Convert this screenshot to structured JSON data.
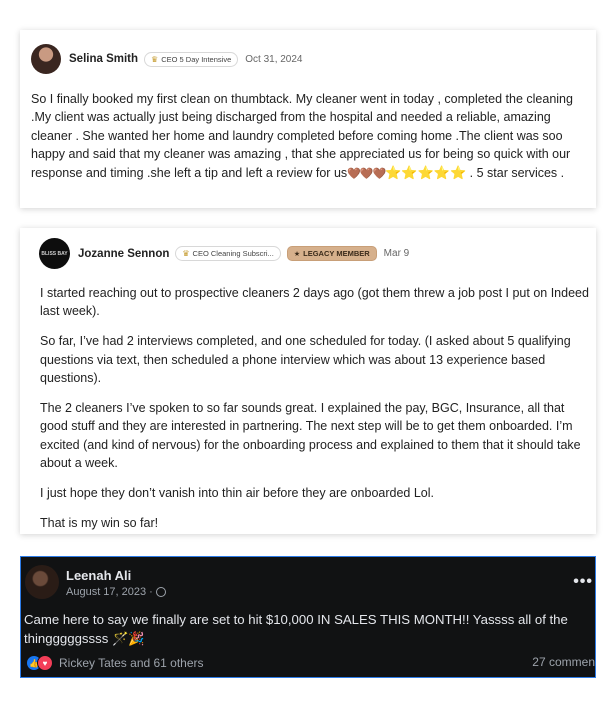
{
  "post1": {
    "author": "Selina Smith",
    "badge": "CEO 5 Day Intensive",
    "badge_icon": "crown-icon",
    "date": "Oct 31, 2024",
    "text_main": "So I finally booked my first clean on thumbtack. My cleaner went in today , completed the cleaning .My client was actually just being discharged from the hospital and needed a reliable, amazing cleaner . She wanted her home and laundry completed before coming home .The client was soo happy and said that my cleaner was amazing , that she appreciated us for being so quick with our response and timing .she left a tip and left a review for us",
    "emoji_hearts": "🤎🤎🤎",
    "emoji_stars": "⭐⭐⭐⭐⭐",
    "text_end": " . 5 star services ."
  },
  "post2": {
    "author": "Jozanne Sennon",
    "avatar_text": "BLISS BAY",
    "badge": "CEO Cleaning Subscri...",
    "legacy_badge": "LEGACY MEMBER",
    "date": "Mar 9",
    "paragraphs": [
      "I started reaching out to prospective cleaners 2 days ago (got them threw a job post I put on Indeed last week).",
      "So far, I’ve had 2 interviews completed, and one scheduled for today. (I asked about 5 qualifying questions via text, then scheduled a phone interview which was about 13 experience based questions).",
      "The 2 cleaners I’ve spoken to so far sounds great. I explained the pay, BGC, Insurance, all that good stuff and they are interested in partnering. The next step will be to get them onboarded. I’m excited (and kind of nervous) for the onboarding process and explained to them that it should take about a week.",
      "I just hope they don’t vanish into thin air before they are onboarded Lol.",
      "That is my win so far!"
    ]
  },
  "post3": {
    "author": "Leenah Ali",
    "date": "August 17, 2023 ·",
    "privacy_icon": "globe-icon",
    "text": "Came here to say we finally are set to hit $10,000 IN SALES THIS MONTH!! Yassss all of the thingggggssss 🪄🎉",
    "reactions_text": "Rickey Tates and 61 others",
    "comments": "27 commen",
    "more_icon": "•••"
  },
  "colors": {
    "fb_bg": "#111213",
    "fb_border": "#2d7ce8",
    "like_blue": "#1877f2",
    "love_red": "#f33e58",
    "legacy_gold": "#d6b08c"
  }
}
